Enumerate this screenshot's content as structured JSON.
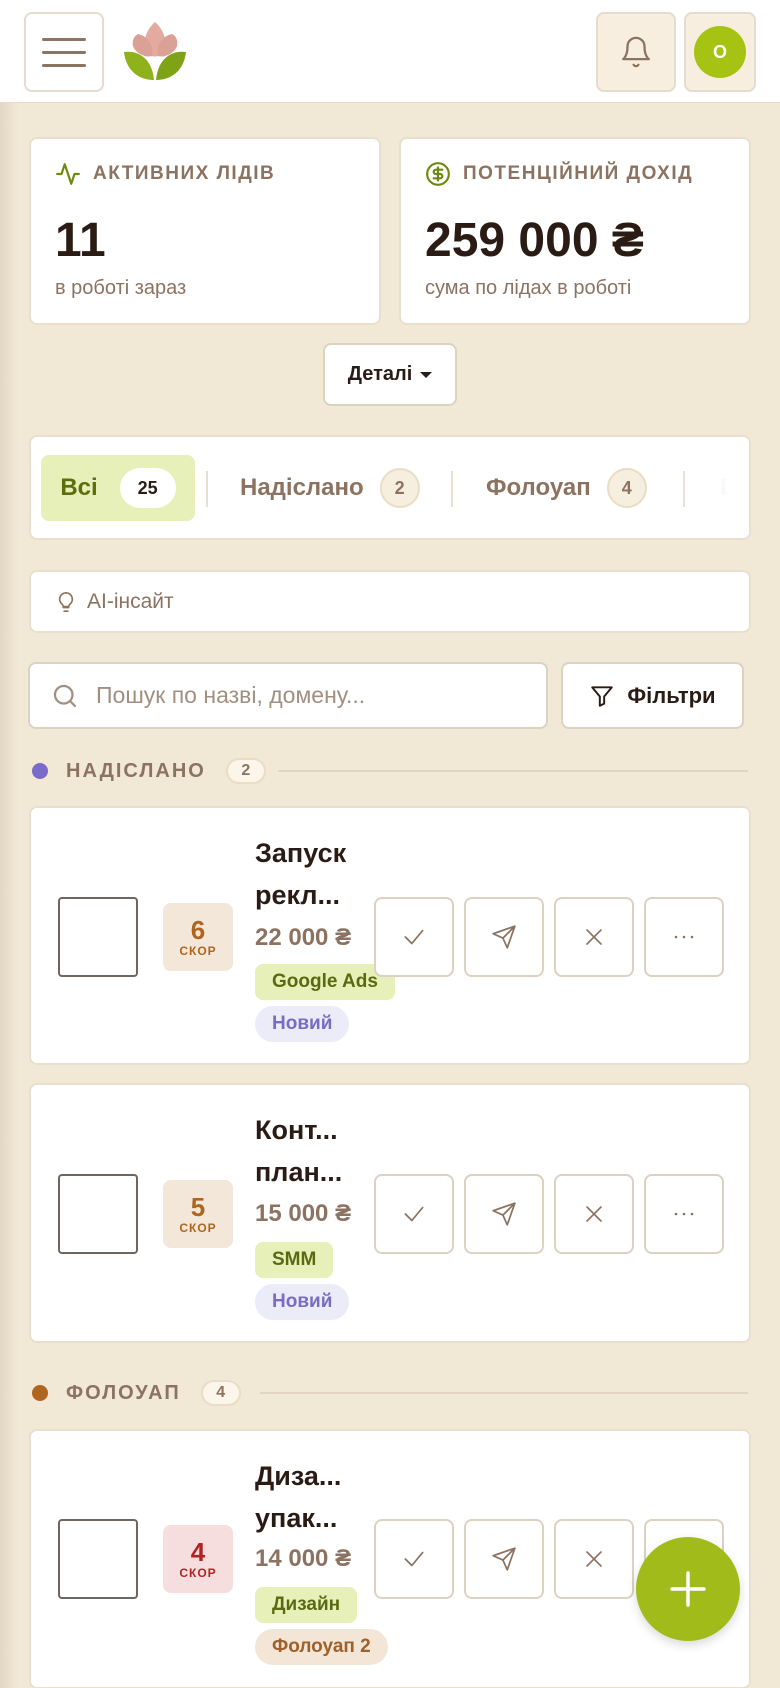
{
  "header": {
    "menu_icon": "hamburger-icon",
    "logo_icon": "lotus-logo-icon",
    "bell_icon": "bell-icon",
    "avatar_initial": "O"
  },
  "stats": {
    "active": {
      "label": "АКТИВНИХ ЛІДІВ",
      "value": "11",
      "sub": "в роботі зараз",
      "icon": "activity-icon"
    },
    "income": {
      "label": "ПОТЕНЦІЙНИЙ ДОХІД",
      "value": "259 000 ₴",
      "sub": "сума по лідах в роботі",
      "icon": "dollar-circle-icon"
    }
  },
  "details_label": "Деталі",
  "tabs": [
    {
      "label": "Всі",
      "count": "25",
      "active": true
    },
    {
      "label": "Надіслано",
      "count": "2",
      "active": false
    },
    {
      "label": "Фолоуап",
      "count": "4",
      "active": false
    },
    {
      "label": "Ві",
      "count": "",
      "active": false
    }
  ],
  "insight_label": "AI-інсайт",
  "search": {
    "placeholder": "Пошук по назві, домену...",
    "value": ""
  },
  "filters_label": "Фільтри",
  "groups": [
    {
      "title": "НАДІСЛАНО",
      "count": "2",
      "color": "#7b6bc8"
    },
    {
      "title": "ФОЛОУАП",
      "count": "4",
      "color": "#b0651f"
    }
  ],
  "leads": [
    {
      "name_line1": "Запуск",
      "name_line2": "рекл...",
      "score": "6",
      "score_label": "СКОР",
      "price": "22 000 ₴",
      "category": "Google Ads",
      "status": "Новий"
    },
    {
      "name_line1": "Конт...",
      "name_line2": "план...",
      "score": "5",
      "score_label": "СКОР",
      "price": "15 000 ₴",
      "category": "SMM",
      "status": "Новий"
    },
    {
      "name_line1": "Диза...",
      "name_line2": "упак...",
      "score": "4",
      "score_label": "СКОР",
      "price": "14 000 ₴",
      "category": "Дизайн",
      "status": "Фолоуап 2"
    }
  ],
  "colors": {
    "accent": "#a6c313",
    "background": "#f1e8d6",
    "score_high_bg": "#f3e7da",
    "score_high_fg": "#b0651f",
    "score_low_bg": "#f6dede",
    "score_low_fg": "#b22222"
  }
}
